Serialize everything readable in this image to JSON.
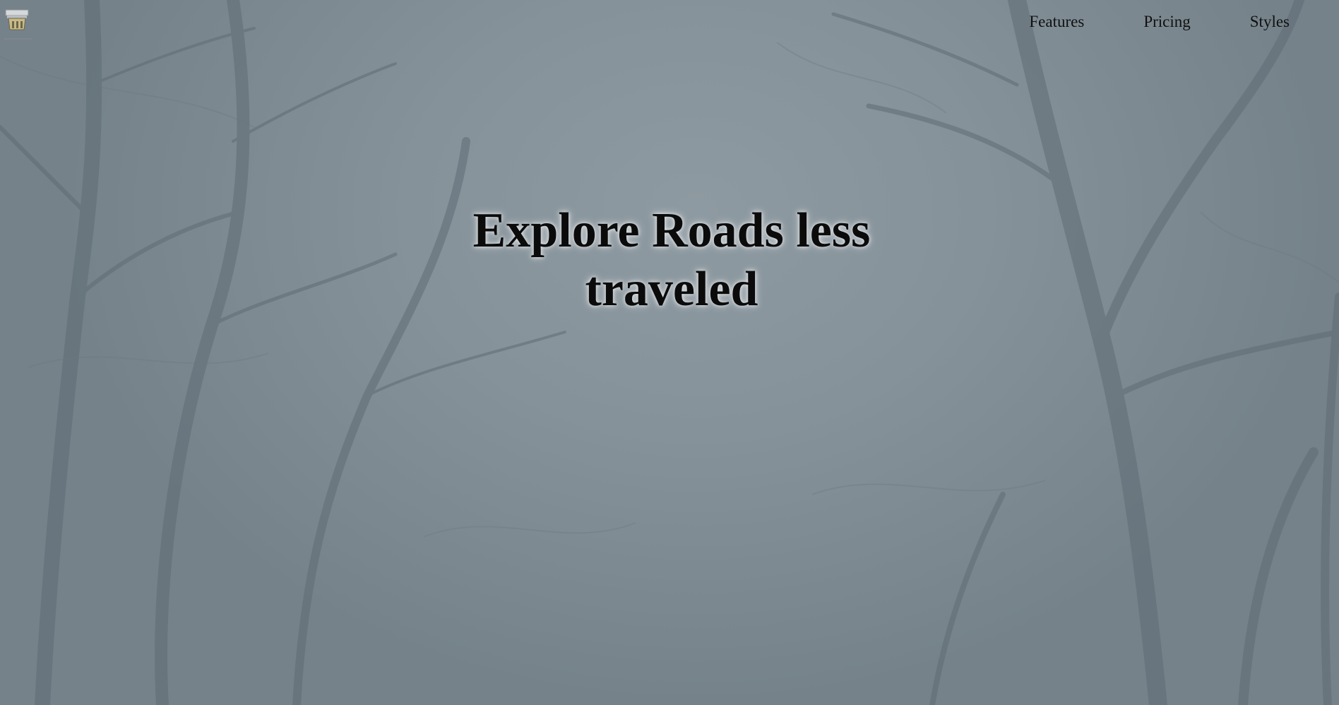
{
  "header": {
    "logo_icon": "bookstand-icon",
    "nav": [
      {
        "label": "Features"
      },
      {
        "label": "Pricing"
      },
      {
        "label": "Styles"
      }
    ]
  },
  "hero": {
    "headline": "Explore Roads less traveled",
    "background": "foggy-forest-photo"
  },
  "colors": {
    "background": "#86929a",
    "text": "#0b0b0b"
  }
}
